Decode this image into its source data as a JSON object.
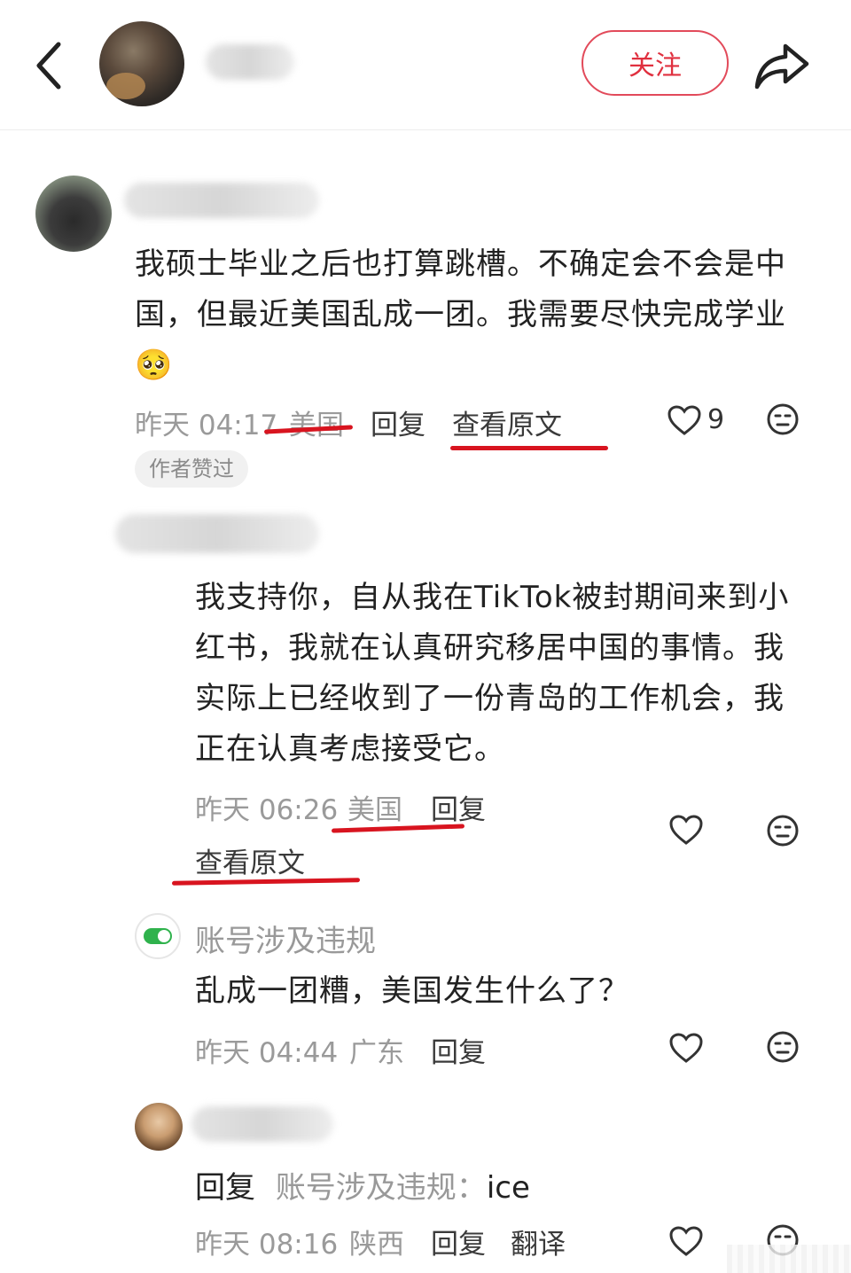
{
  "header": {
    "follow_label": "关注"
  },
  "comments": [
    {
      "text": "我硕士毕业之后也打算跳槽。不确定会不会是中国，但最近美国乱成一团。我需要尽快完成学业",
      "emoji": "🥺",
      "time": "昨天 04:17",
      "location": "美国",
      "reply_label": "回复",
      "view_original_label": "查看原文",
      "like_count": "9",
      "author_liked_badge": "作者赞过"
    },
    {
      "text": "我支持你，自从我在TikTok被封期间来到小红书，我就在认真研究移居中国的事情。我实际上已经收到了一份青岛的工作机会，我正在认真考虑接受它。",
      "time": "昨天 06:26",
      "location": "美国",
      "reply_label": "回复",
      "view_original_label": "查看原文"
    },
    {
      "user_name": "账号涉及违规",
      "text": "乱成一团糟，美国发生什么了？",
      "time": "昨天 04:44",
      "location": "广东",
      "reply_label": "回复"
    },
    {
      "reply_prefix": "回复",
      "reply_to": "账号涉及违规",
      "text": "ice",
      "time": "昨天 08:16",
      "location": "陕西",
      "reply_label": "回复",
      "translate_label": "翻译"
    }
  ],
  "colors": {
    "accent_red": "#e0303f",
    "annotation_red": "#d8141f",
    "meta_gray": "#9a9a9a"
  }
}
